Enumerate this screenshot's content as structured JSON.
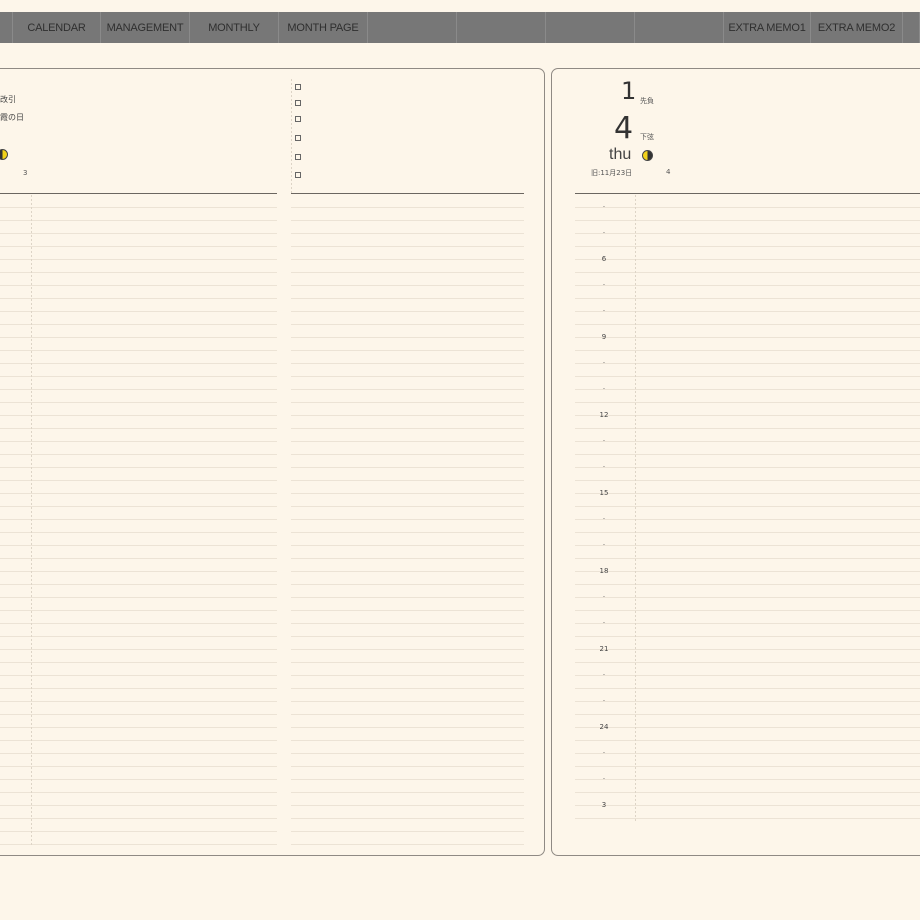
{
  "nav": {
    "tabs": [
      {
        "label": ""
      },
      {
        "label": "CALENDAR"
      },
      {
        "label": "MANAGEMENT"
      },
      {
        "label": "MONTHLY"
      },
      {
        "label": "MONTH PAGE"
      },
      {
        "label": ""
      },
      {
        "label": ""
      },
      {
        "label": ""
      },
      {
        "label": "EXTRA MEMO1"
      },
      {
        "label": "EXTRA MEMO2"
      },
      {
        "label": ""
      }
    ]
  },
  "left_page": {
    "note_line1": "改引",
    "note_line2": "霞の日",
    "small_number": "3"
  },
  "right_page": {
    "month_number": "1",
    "rokuyo": "先負",
    "day_number": "4",
    "moon_phase": "下弦",
    "weekday": "thu",
    "lunar_date": "旧:11月23日",
    "small_number": "4",
    "hours": [
      "",
      "",
      "6",
      "",
      "",
      "9",
      "",
      "",
      "12",
      "",
      "",
      "15",
      "",
      "",
      "18",
      "",
      "",
      "21",
      "",
      "",
      "24",
      "",
      "",
      "3"
    ]
  }
}
